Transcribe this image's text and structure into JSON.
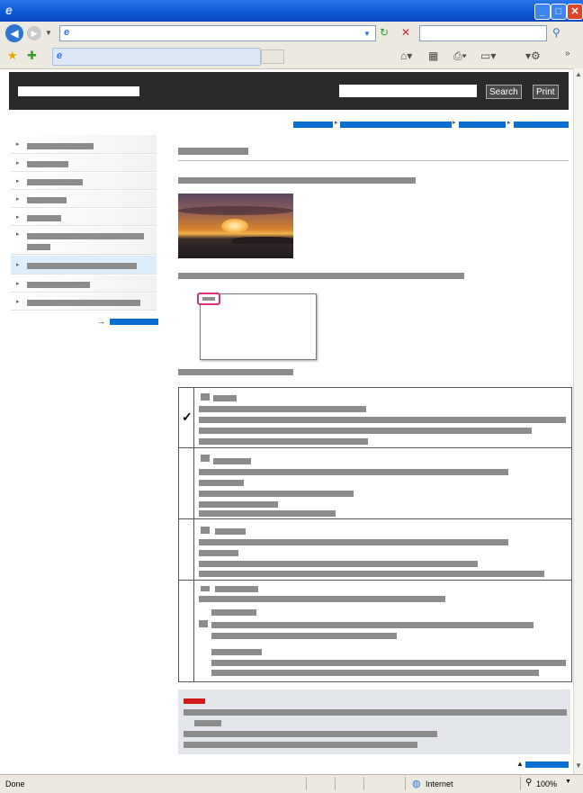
{
  "window": {
    "title": "",
    "status": "Done",
    "zone": "Internet",
    "zoom": "100%"
  },
  "header": {
    "search_label": "Search",
    "print_label": "Print"
  },
  "icons": {
    "ie_logo": "ie-logo-icon",
    "back": "back-arrow-icon",
    "forward": "forward-arrow-icon",
    "refresh": "refresh-icon",
    "stop": "stop-icon",
    "favorites": "star-icon",
    "home": "home-icon",
    "print": "print-icon",
    "tools": "gear-icon",
    "check": "checkmark-icon",
    "internet": "globe-icon"
  },
  "content": {
    "check_mark": "✓"
  },
  "colors": {
    "link_blue": "#0a6fd0",
    "header_bg": "#2a2a2a",
    "title_blue": "#0d56d6",
    "highlight_pink": "#e0307a",
    "alert_red": "#d11a1a"
  }
}
